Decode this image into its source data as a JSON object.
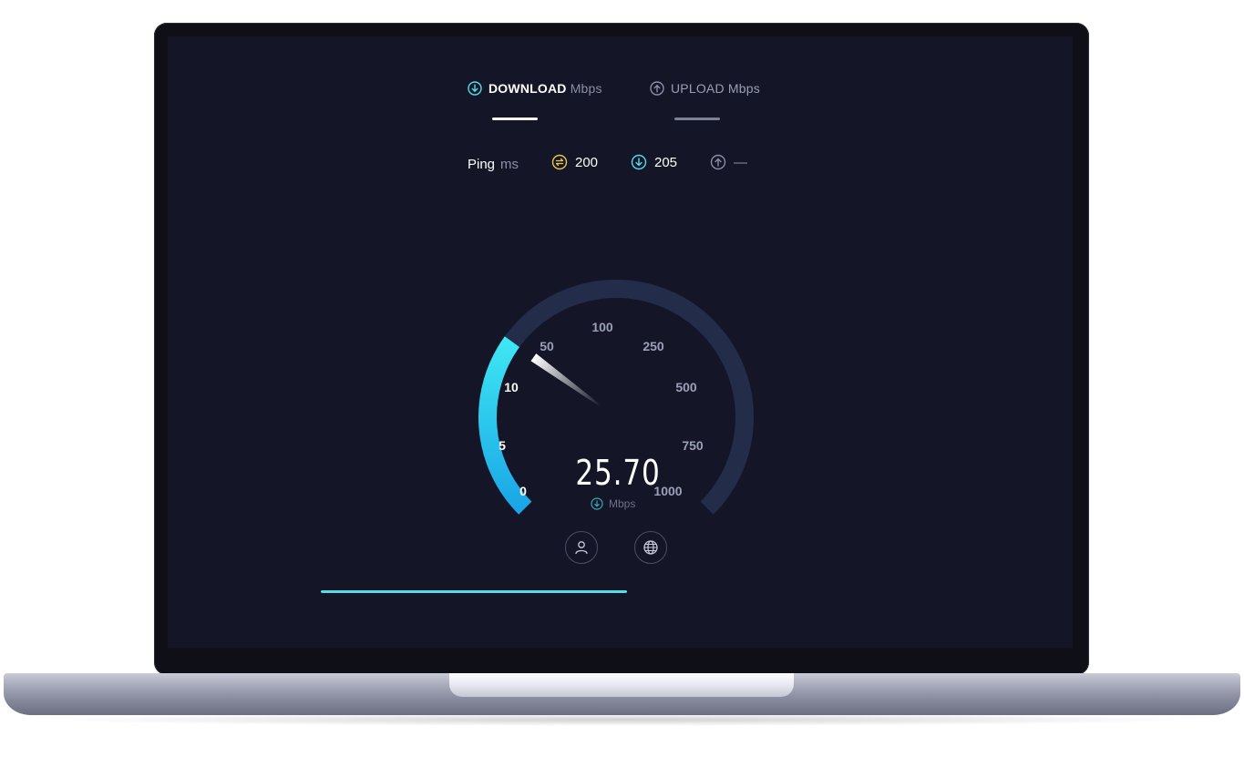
{
  "tabs": {
    "download": {
      "label": "DOWNLOAD",
      "unit": "Mbps",
      "active": true
    },
    "upload": {
      "label": "UPLOAD Mbps",
      "active": false
    }
  },
  "ping": {
    "label": "Ping",
    "unit": "ms",
    "idle_value": "200",
    "download_value": "205",
    "upload_value": "—"
  },
  "gauge": {
    "tick_labels": [
      "0",
      "5",
      "10",
      "50",
      "100",
      "250",
      "500",
      "750",
      "1000"
    ],
    "current_value": "25.70",
    "unit": "Mbps",
    "fill_fraction": 0.3,
    "needle_fraction": 0.3
  },
  "progress": {
    "fraction": 1.0
  },
  "colors": {
    "background": "#141628",
    "accent_cyan": "#54dde9",
    "idle_yellow": "#e8c94a",
    "gauge_track": "#232d4a"
  },
  "icons": {
    "download": "download-arrow-icon",
    "upload": "upload-arrow-icon",
    "idle": "idle-ping-icon",
    "profile": "user-icon",
    "globe": "globe-icon"
  }
}
